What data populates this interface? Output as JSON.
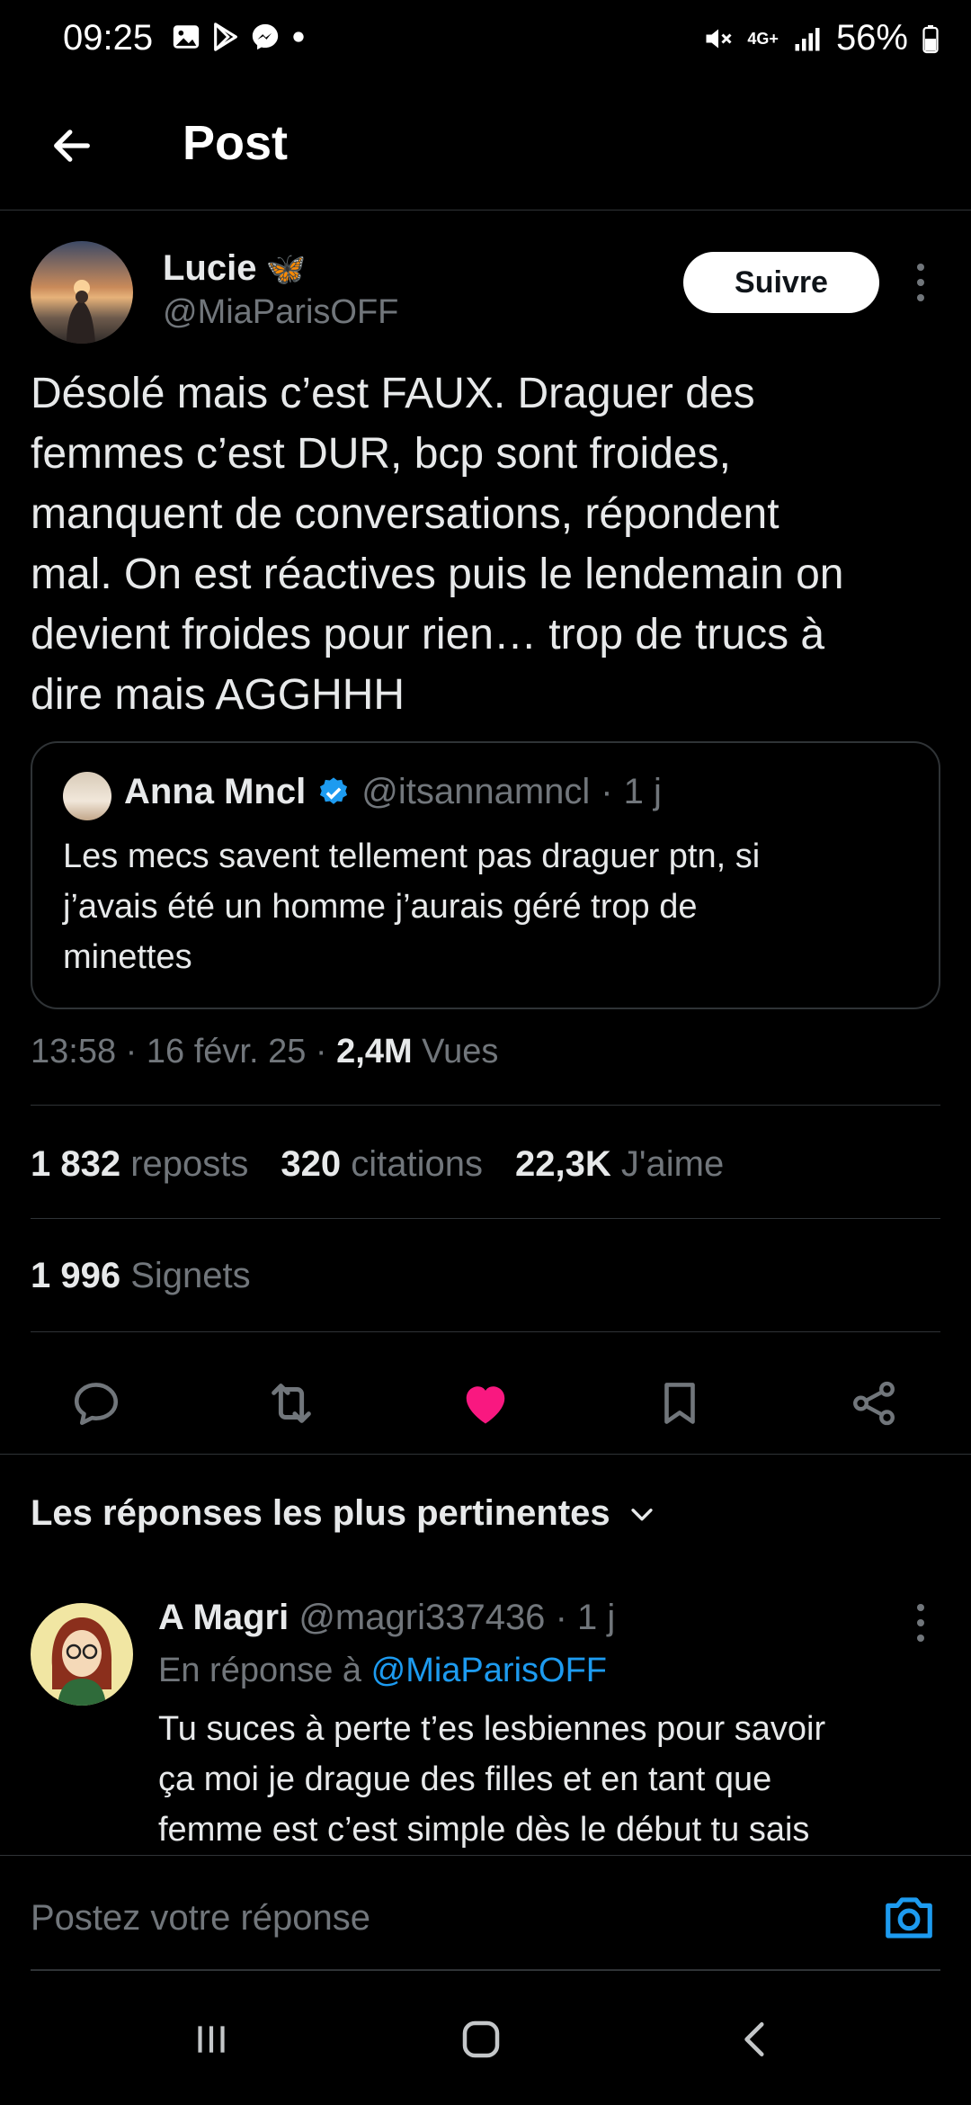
{
  "status_bar": {
    "time": "09:25",
    "notification_icons": [
      "gallery-icon",
      "play-store-icon",
      "messenger-icon",
      "dot-icon"
    ],
    "right_icons": [
      "mute-icon",
      "4g-plus-icon",
      "signal-icon"
    ],
    "network": "4G+",
    "battery_percent": "56%"
  },
  "header": {
    "back_icon": "arrow-left-icon",
    "title": "Post"
  },
  "post": {
    "author": {
      "name": "Lucie",
      "name_emoji": "🦋",
      "handle": "@MiaParisOFF"
    },
    "follow_label": "Suivre",
    "text": "Désolé mais c’est FAUX. Draguer des\nfemmes c’est DUR, bcp sont froides,\nmanquent de conversations, répondent\nmal. On est réactives puis le lendemain on\ndevient froides pour rien… trop de trucs à\ndire mais AGGHHH",
    "quote": {
      "name": "Anna Mncl",
      "verified": true,
      "handle": "@itsannamncl",
      "separator": "·",
      "age": "1 j",
      "text": "Les mecs savent tellement pas draguer ptn, si\nj’avais été un homme j’aurais géré trop de\nminettes"
    },
    "meta": {
      "time": "13:58",
      "date": "16 févr. 25",
      "views_count": "2,4M",
      "views_label": "Vues"
    },
    "stats": {
      "reposts_count": "1 832",
      "reposts_label": "reposts",
      "quotes_count": "320",
      "quotes_label": "citations",
      "likes_count": "22,3K",
      "likes_label": "J'aime",
      "bookmarks_count": "1 996",
      "bookmarks_label": "Signets"
    },
    "actions": [
      "reply-icon",
      "repost-icon",
      "like-icon",
      "bookmark-icon",
      "share-icon"
    ],
    "liked": true,
    "like_color": "#f91880"
  },
  "replies": {
    "sort_label": "Les réponses les plus pertinentes",
    "items": [
      {
        "name": "A Magri",
        "handle": "@magri337436",
        "separator": "·",
        "age": "1 j",
        "reply_to_label": "En réponse à",
        "reply_to_handle": "@MiaParisOFF",
        "text": "Tu suces à perte t’es lesbiennes pour savoir\nça moi je drague des filles et en tant que\nfemme est c’est simple dès le début tu sais"
      }
    ]
  },
  "composer": {
    "placeholder": "Postez votre réponse",
    "camera_icon": "camera-icon"
  },
  "nav_bar": [
    "recent-apps-icon",
    "home-icon",
    "back-icon"
  ],
  "colors": {
    "background": "#000000",
    "text": "#e7e9ea",
    "muted": "#71767b",
    "accent": "#1d9bf0",
    "like": "#f91880",
    "divider": "#2f3336"
  }
}
